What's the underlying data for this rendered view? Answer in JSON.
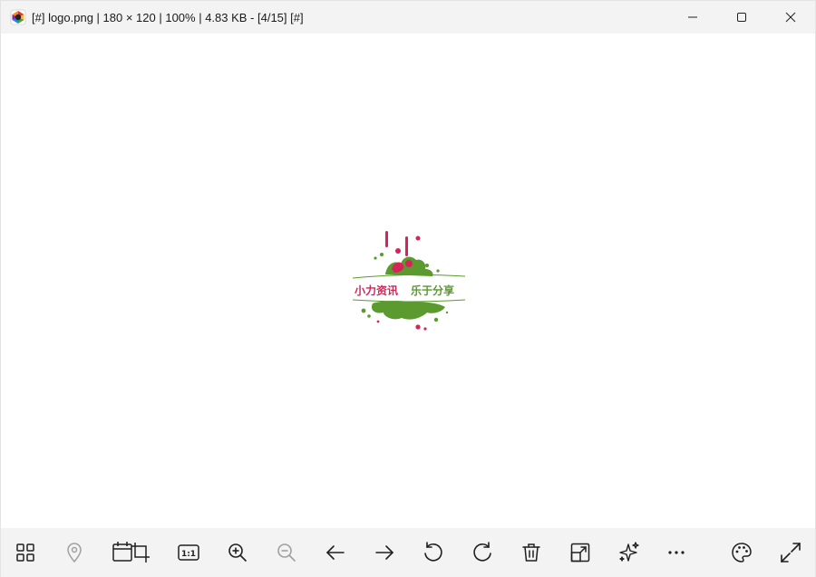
{
  "window": {
    "title": "[#] logo.png  |  180 × 120  |  100%  |  4.83 KB  -  [4/15] [#]",
    "controls": [
      "minimize",
      "maximize",
      "close"
    ]
  },
  "image": {
    "logo_text_left": "小力资讯",
    "logo_text_right": "乐于分享"
  },
  "toolbar": {
    "buttons": [
      {
        "icon": "gallery-grid-icon",
        "enabled": true
      },
      {
        "icon": "location-pin-icon",
        "enabled": false
      },
      {
        "icon": "frame-crop-icon",
        "enabled": true
      },
      {
        "icon": "actual-size-icon",
        "label": "1:1",
        "enabled": true
      },
      {
        "icon": "zoom-in-icon",
        "enabled": true
      },
      {
        "icon": "zoom-out-icon",
        "enabled": false
      },
      {
        "icon": "arrow-left-icon",
        "enabled": true
      },
      {
        "icon": "arrow-right-icon",
        "enabled": true
      },
      {
        "icon": "rotate-left-icon",
        "enabled": true
      },
      {
        "icon": "rotate-right-icon",
        "enabled": true
      },
      {
        "icon": "trash-icon",
        "enabled": true
      },
      {
        "icon": "resize-icon",
        "enabled": true
      },
      {
        "icon": "sparkles-icon",
        "enabled": true
      },
      {
        "icon": "more-icon",
        "enabled": true
      },
      {
        "icon": "palette-icon",
        "enabled": true
      },
      {
        "icon": "fullscreen-icon",
        "enabled": true
      }
    ]
  },
  "colors": {
    "titlebar_bg": "#f3f3f3",
    "toolbar_bg": "#f3f3f3",
    "icon_color": "#1f1f1f",
    "icon_disabled": "#a0a0a0",
    "logo_green": "#5a9a2e",
    "logo_red": "#d6245a"
  }
}
